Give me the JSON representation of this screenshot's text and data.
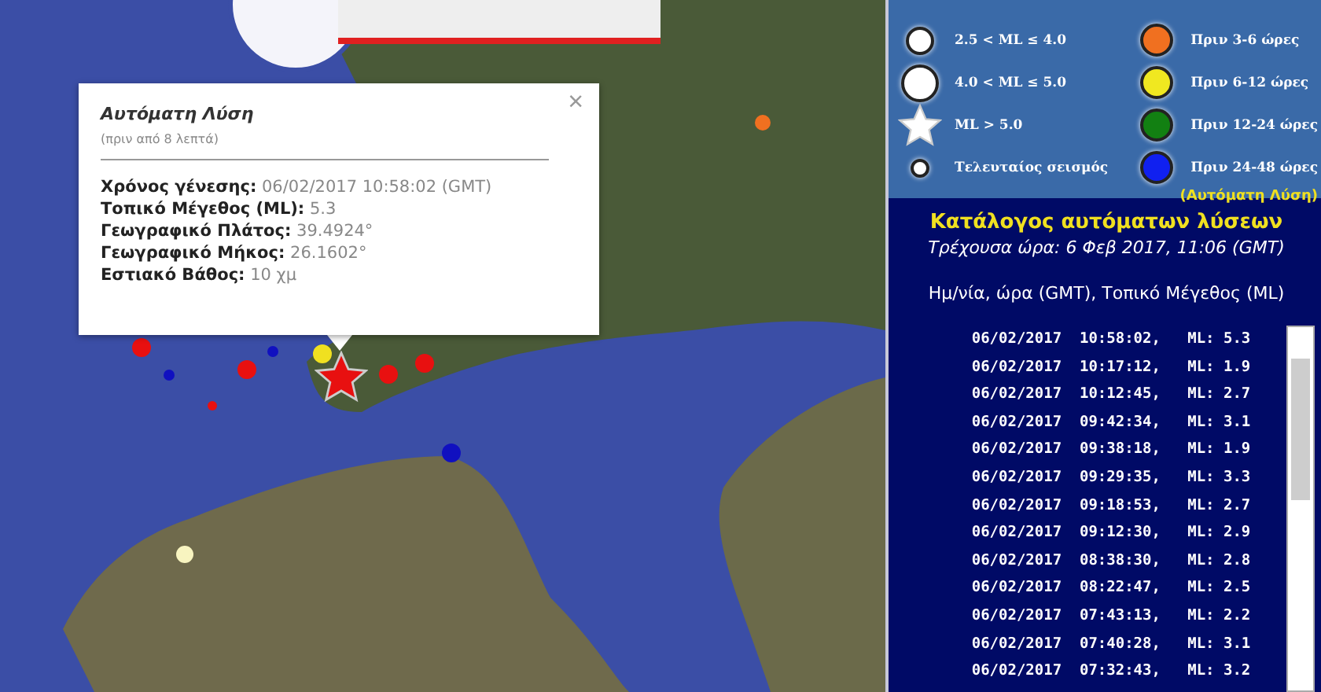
{
  "popup": {
    "title": "Αυτόματη Λύση",
    "subtitle": "(πριν από 8 λεπτά)",
    "close": "×",
    "fields": [
      {
        "label": "Χρόνος γένεσης:",
        "value": "06/02/2017  10:58:02 (GMT)"
      },
      {
        "label": "Τοπικό Μέγεθος (ML):",
        "value": "5.3"
      },
      {
        "label": "Γεωγραφικό Πλάτος:",
        "value": "39.4924°"
      },
      {
        "label": "Γεωγραφικό Μήκος:",
        "value": "26.1602°"
      },
      {
        "label": "Εστιακό Βάθος:",
        "value": "10 χμ"
      }
    ]
  },
  "markers": [
    {
      "kind": "circle",
      "color": "#f07020"
    },
    {
      "kind": "circle",
      "color": "#e81010"
    },
    {
      "kind": "dot",
      "color": "#1010c0"
    },
    {
      "kind": "circle",
      "color": "#e81010"
    },
    {
      "kind": "dot",
      "color": "#1010c0"
    },
    {
      "kind": "dot",
      "color": "#e81010"
    },
    {
      "kind": "circle",
      "color": "#f0e020"
    },
    {
      "kind": "circle",
      "color": "#e81010"
    },
    {
      "kind": "circle",
      "color": "#e81010"
    },
    {
      "kind": "circle",
      "color": "#1010c0"
    },
    {
      "kind": "circle",
      "color": "#f8f4c0"
    },
    {
      "kind": "star",
      "color": "#e81010"
    }
  ],
  "legend": {
    "magnitude_items": [
      {
        "kind": "small",
        "label": "2.5 < ML ≤ 4.0"
      },
      {
        "kind": "large",
        "label": "4.0 < ML ≤ 5.0"
      },
      {
        "kind": "star",
        "label": "ML > 5.0"
      },
      {
        "kind": "dot",
        "label": "Τελευταίος σεισμός"
      }
    ],
    "age_items": [
      {
        "label": "Πριν 3-6 ώρες",
        "color": "#f07020"
      },
      {
        "label": "Πριν 6-12 ώρες",
        "color": "#f0e820"
      },
      {
        "label": "Πριν 12-24 ώρες",
        "color": "#128012"
      },
      {
        "label": "Πριν 24-48 ώρες",
        "color": "#1020f0"
      }
    ],
    "note": "(Αυτόματη Λύση)"
  },
  "catalog": {
    "title": "Κατάλογος αυτόματων λύσεων",
    "current_time": "Τρέχουσα ώρα: 6 Φεβ 2017, 11:06 (GMT)",
    "column_header": "Ημ/νία, ώρα (GMT), Τοπικό Μέγεθος (ML)",
    "rows": [
      "06/02/2017  10:58:02,   ML: 5.3",
      "06/02/2017  10:17:12,   ML: 1.9",
      "06/02/2017  10:12:45,   ML: 2.7",
      "06/02/2017  09:42:34,   ML: 3.1",
      "06/02/2017  09:38:18,   ML: 1.9",
      "06/02/2017  09:29:35,   ML: 3.3",
      "06/02/2017  09:18:53,   ML: 2.7",
      "06/02/2017  09:12:30,   ML: 2.9",
      "06/02/2017  08:38:30,   ML: 2.8",
      "06/02/2017  08:22:47,   ML: 2.5",
      "06/02/2017  07:43:13,   ML: 2.2",
      "06/02/2017  07:40:28,   ML: 3.1",
      "06/02/2017  07:32:43,   ML: 3.2"
    ]
  }
}
